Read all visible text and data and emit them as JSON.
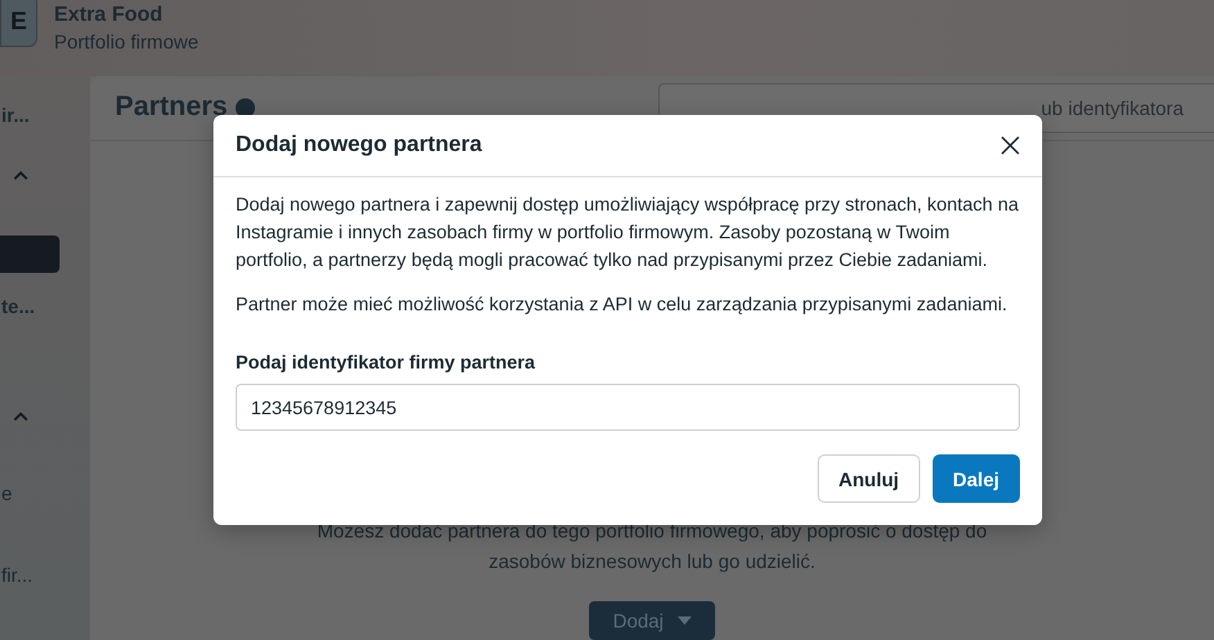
{
  "header": {
    "logo": "E",
    "title": "Extra Food",
    "subtitle": "Portfolio firmowe"
  },
  "sidebar": {
    "items": [
      {
        "kind": "text",
        "label": "ir..."
      },
      {
        "kind": "chevron",
        "expanded": true
      },
      {
        "kind": "highlight",
        "selected": true
      },
      {
        "kind": "text",
        "label": "te..."
      },
      {
        "kind": "chevron",
        "expanded": true
      },
      {
        "kind": "text",
        "label": "e"
      },
      {
        "kind": "text",
        "label": "fir..."
      }
    ]
  },
  "page": {
    "title": "Partners",
    "search": {
      "placeholder": "ub identyfikatora"
    },
    "empty_state": "Możesz dodać partnera do tego portfolio firmowego, aby poprosić o dostęp do zasobów biznesowych lub go udzielić.",
    "add_button": {
      "label": "Dodaj"
    }
  },
  "dialog": {
    "title": "Dodaj nowego partnera",
    "paragraphs": [
      "Dodaj nowego partnera i zapewnij dostęp umożliwiający współpracę przy stronach, kontach na Instagramie i innych zasobach firmy w portfolio firmowym. Zasoby pozostaną w Twoim portfolio, a partnerzy będą mogli pracować tylko nad przypisanymi przez Ciebie zadaniami.",
      "Partner może mieć możliwość korzystania z API w celu zarządzania przypisanymi zadaniami."
    ],
    "field": {
      "label": "Podaj identyfikator firmy partnera",
      "value": "12345678912345"
    },
    "buttons": [
      {
        "label": "Anuluj",
        "kind": "secondary"
      },
      {
        "label": "Dalej",
        "kind": "primary"
      }
    ]
  }
}
